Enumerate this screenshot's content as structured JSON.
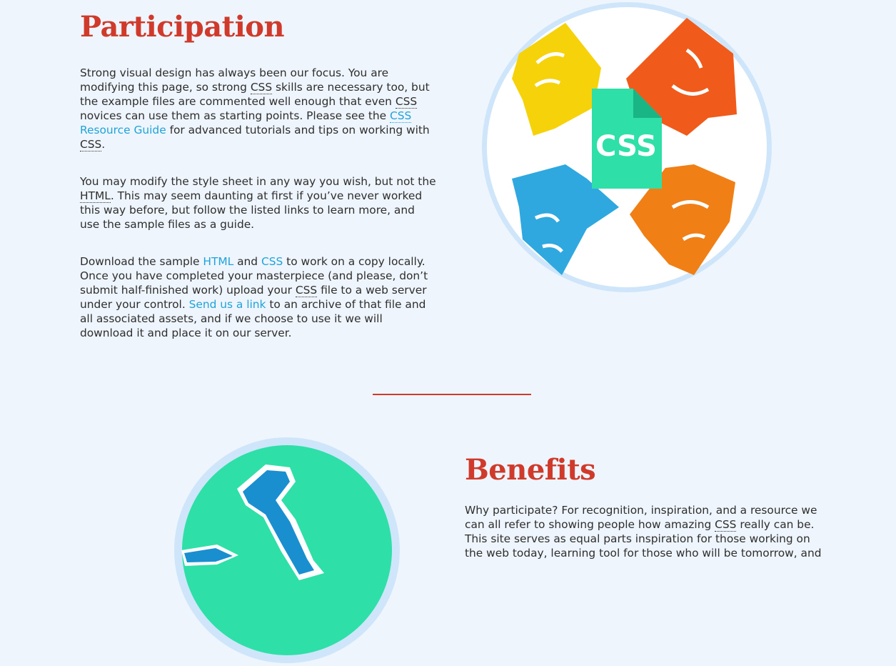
{
  "participation": {
    "title": "Participation",
    "p1": [
      {
        "t": "text",
        "v": "Strong visual design has always been our focus. You are modifying this page, so strong "
      },
      {
        "t": "abbr",
        "v": "CSS"
      },
      {
        "t": "text",
        "v": " skills are necessary too, but the example files are commented well enough that even "
      },
      {
        "t": "abbr",
        "v": "CSS"
      },
      {
        "t": "text",
        "v": " novices can use them as starting points. Please see the "
      },
      {
        "t": "link",
        "v": "CSS Resource Guide",
        "abbr": "CSS",
        "rest": " Resource Guide"
      },
      {
        "t": "text",
        "v": " for advanced tutorials and tips on working with "
      },
      {
        "t": "abbr",
        "v": "CSS"
      },
      {
        "t": "text",
        "v": "."
      }
    ],
    "p2": [
      {
        "t": "text",
        "v": "You may modify the style sheet in any way you wish, but not the "
      },
      {
        "t": "abbr",
        "v": "HTML"
      },
      {
        "t": "text",
        "v": ". This may seem daunting at first if you’ve never worked this way before, but follow the listed links to learn more, and use the sample files as a guide."
      }
    ],
    "p3": [
      {
        "t": "text",
        "v": "Download the sample "
      },
      {
        "t": "link",
        "v": "HTML"
      },
      {
        "t": "text",
        "v": " and "
      },
      {
        "t": "link",
        "v": "CSS"
      },
      {
        "t": "text",
        "v": " to work on a copy locally. Once you have completed your masterpiece (and please, don’t submit half-finished work) upload your "
      },
      {
        "t": "abbr",
        "v": "CSS"
      },
      {
        "t": "text",
        "v": " file to a web server under your control. "
      },
      {
        "t": "link",
        "v": "Send us a link"
      },
      {
        "t": "text",
        "v": " to an archive of that file and all associated assets, and if we choose to use it we will download it and place it on our server."
      }
    ],
    "badge_text": "CSS"
  },
  "benefits": {
    "title": "Benefits",
    "p1": [
      {
        "t": "text",
        "v": "Why participate? For recognition, inspiration, and a resource we can all refer to showing people how amazing "
      },
      {
        "t": "abbr",
        "v": "CSS"
      },
      {
        "t": "text",
        "v": " really can be. This site serves as equal parts inspiration for those working on the web today, learning tool for those who will be tomorrow, and"
      }
    ]
  },
  "colors": {
    "heading": "#cf3a2b",
    "link": "#1fa3d8",
    "background": "#eef5fd",
    "hand_yellow": "#f6d20a",
    "hand_red": "#f05a1a",
    "hand_blue": "#2fa8e0",
    "hand_orange": "#f07f16",
    "css_badge": "#2ee0a8",
    "arm_bg": "#2ee0a8",
    "arm_blue": "#1a8fd0"
  }
}
